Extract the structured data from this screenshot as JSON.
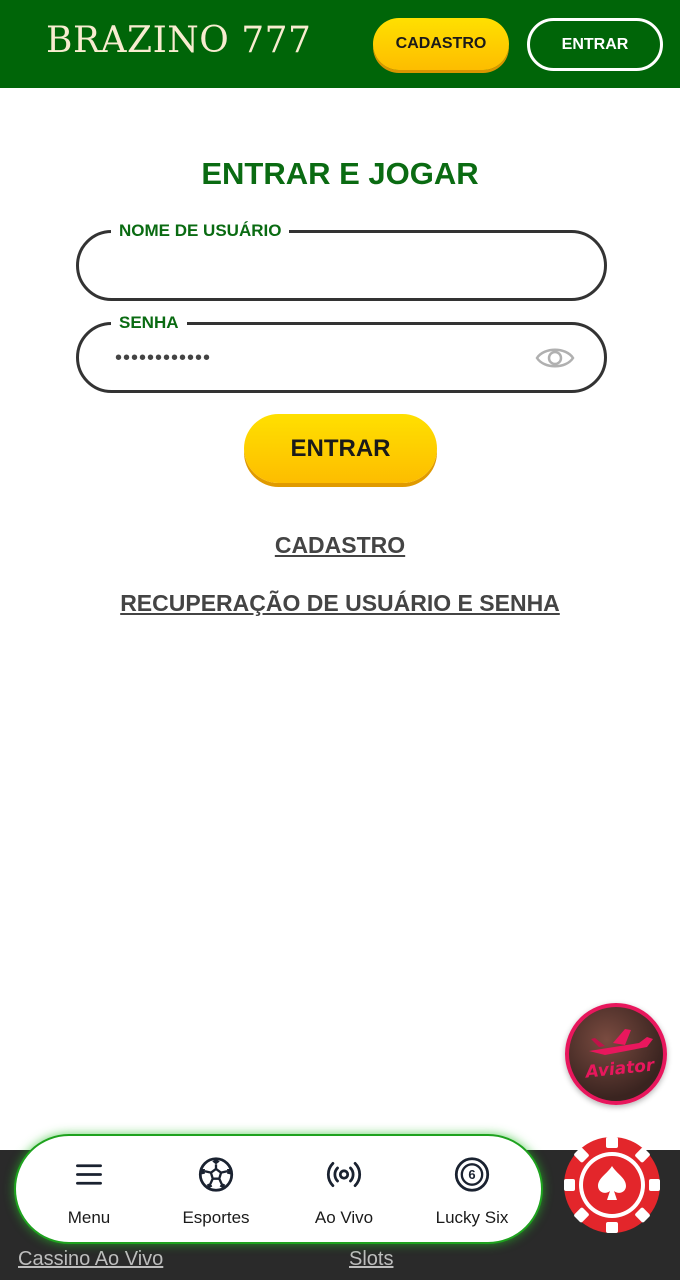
{
  "header": {
    "logo_text": "BRAZINO 777",
    "cadastro_label": "CADASTRO",
    "entrar_label": "ENTRAR"
  },
  "login": {
    "title": "ENTRAR E JOGAR",
    "username_label": "NOME DE USUÁRIO",
    "username_value": "",
    "password_label": "SENHA",
    "password_value": "••••••••••••",
    "submit_label": "ENTRAR",
    "cadastro_link": "CADASTRO",
    "recovery_link": "RECUPERAÇÃO DE USUÁRIO E SENHA"
  },
  "promo": {
    "aviator_text": "Aviator"
  },
  "bottom_nav": {
    "items": [
      {
        "label": "Menu",
        "icon": "hamburger-icon"
      },
      {
        "label": "Esportes",
        "icon": "soccer-ball-icon"
      },
      {
        "label": "Ao Vivo",
        "icon": "live-broadcast-icon"
      },
      {
        "label": "Lucky Six",
        "icon": "lucky-six-ball-icon",
        "badge": "6"
      }
    ]
  },
  "footer_links": {
    "cassino": "Cassino Ao Vivo",
    "slots": "Slots"
  },
  "colors": {
    "header_green": "#006508",
    "title_green": "#0a6b12",
    "yellow": "#fdbd00",
    "casino_red": "#e3262b"
  }
}
